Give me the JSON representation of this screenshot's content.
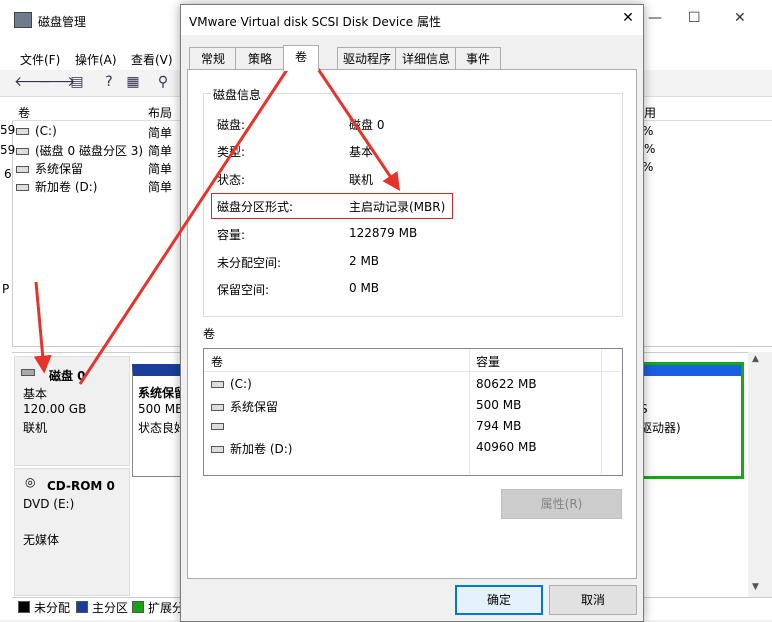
{
  "background": {
    "title": "磁盘管理",
    "controls": {
      "minimize": "—",
      "maximize": "☐",
      "close": "✕"
    },
    "menu": [
      "文件(F)",
      "操作(A)",
      "查看(V)"
    ],
    "list_headers": [
      "卷",
      "布局",
      "用"
    ],
    "volumes": [
      {
        "name": "(C:)",
        "layout": "简单"
      },
      {
        "name": "(磁盘 0 磁盘分区 3)",
        "layout": "简单"
      },
      {
        "name": "系统保留",
        "layout": "简单"
      },
      {
        "name": "新加卷 (D:)",
        "layout": "简单"
      }
    ],
    "left_clip": [
      "59",
      "59",
      "6",
      "P"
    ],
    "right_clip": [
      "%",
      "%",
      "%"
    ],
    "disk0": {
      "name": "磁盘 0",
      "type": "基本",
      "size": "120.00 GB",
      "status": "联机"
    },
    "cdrom": {
      "name": "CD-ROM 0",
      "type": "DVD (E:)",
      "status": "无媒体"
    },
    "partition_sys": {
      "name": "系统保留",
      "size": "500 MB",
      "status": "状态良好"
    },
    "partition_right": {
      "line1": "S",
      "line2": "驱动器)"
    },
    "legend": [
      "未分配",
      "主分区",
      "扩展分"
    ],
    "legend_colors": [
      "#000000",
      "#1a3e9c",
      "#1aa11a"
    ]
  },
  "dialog": {
    "title": "VMware Virtual disk SCSI Disk Device 属性",
    "close_label": "✕",
    "tabs": [
      "常规",
      "策略",
      "卷",
      "驱动程序",
      "详细信息",
      "事件"
    ],
    "active_tab": "卷",
    "disk_info_label": "磁盘信息",
    "info": [
      {
        "label": "磁盘:",
        "value": "磁盘 0"
      },
      {
        "label": "类型:",
        "value": "基本"
      },
      {
        "label": "状态:",
        "value": "联机"
      },
      {
        "label": "磁盘分区形式:",
        "value": "主启动记录(MBR)"
      },
      {
        "label": "容量:",
        "value": "122879 MB"
      },
      {
        "label": "未分配空间:",
        "value": "2 MB"
      },
      {
        "label": "保留空间:",
        "value": "0 MB"
      }
    ],
    "volumes_label": "卷",
    "volume_headers": [
      "卷",
      "容量"
    ],
    "volume_rows": [
      {
        "name": "(C:)",
        "capacity": "80622 MB"
      },
      {
        "name": "系统保留",
        "capacity": "500 MB"
      },
      {
        "name": "",
        "capacity": "794 MB"
      },
      {
        "name": "新加卷 (D:)",
        "capacity": "40960 MB"
      }
    ],
    "properties_button": "属性(R)",
    "ok_button": "确定",
    "cancel_button": "取消"
  },
  "annotation_color": "#e8322a"
}
